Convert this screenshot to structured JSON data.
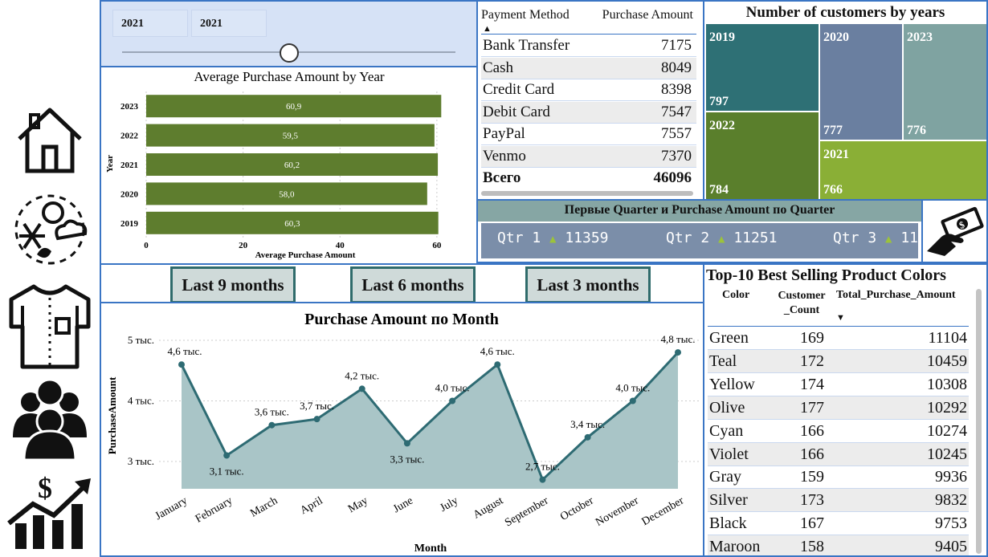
{
  "slicer": {
    "start_year": "2021",
    "end_year": "2021",
    "value_fraction": 0.5
  },
  "payment_table": {
    "col_method": "Payment Method",
    "col_amount": "Purchase Amount",
    "rows": [
      {
        "method": "Bank Transfer",
        "amount": "7175"
      },
      {
        "method": "Cash",
        "amount": "8049"
      },
      {
        "method": "Credit Card",
        "amount": "8398"
      },
      {
        "method": "Debit Card",
        "amount": "7547"
      },
      {
        "method": "PayPal",
        "amount": "7557"
      },
      {
        "method": "Venmo",
        "amount": "7370"
      }
    ],
    "total_label": "Всего",
    "total_value": "46096"
  },
  "treemap": {
    "title": "Number of customers by years",
    "tiles": [
      {
        "year": "2019",
        "count": "797",
        "color": "#2e7075"
      },
      {
        "year": "2020",
        "count": "777",
        "color": "#6a7fa0"
      },
      {
        "year": "2023",
        "count": "776",
        "color": "#7fa3a1"
      },
      {
        "year": "2022",
        "count": "784",
        "color": "#5a7f2c"
      },
      {
        "year": "2021",
        "count": "766",
        "color": "#8aaf36"
      }
    ]
  },
  "kpi_strip": {
    "title": "Первые Quarter и Purchase Amount по Quarter",
    "items": [
      {
        "label": "Qtr 1",
        "value": "11359"
      },
      {
        "label": "Qtr 2",
        "value": "11251"
      },
      {
        "label": "Qtr 3",
        "value": "11"
      }
    ],
    "bg": "#7b8ea9",
    "header_bg": "#86a6a4"
  },
  "tabs": {
    "nine": "Last 9 months",
    "six": "Last 6 months",
    "three": "Last 3 months"
  },
  "top_colors": {
    "title": "Top-10 Best Selling Product Colors",
    "col_color": "Color",
    "col_count": "Customer _Count",
    "col_amount": "Total_Purchase_Amount",
    "rows": [
      {
        "color": "Green",
        "count": "169",
        "amount": "11104"
      },
      {
        "color": "Teal",
        "count": "172",
        "amount": "10459"
      },
      {
        "color": "Yellow",
        "count": "174",
        "amount": "10308"
      },
      {
        "color": "Olive",
        "count": "177",
        "amount": "10292"
      },
      {
        "color": "Cyan",
        "count": "166",
        "amount": "10274"
      },
      {
        "color": "Violet",
        "count": "166",
        "amount": "10245"
      },
      {
        "color": "Gray",
        "count": "159",
        "amount": "9936"
      },
      {
        "color": "Silver",
        "count": "173",
        "amount": "9832"
      },
      {
        "color": "Black",
        "count": "167",
        "amount": "9753"
      },
      {
        "color": "Maroon",
        "count": "158",
        "amount": "9405"
      }
    ]
  },
  "nav": {
    "icons": [
      "home-icon",
      "weather-icon",
      "shirt-icon",
      "customers-icon",
      "growth-icon"
    ],
    "money_icon": "money-hand-icon"
  },
  "chart_data": [
    {
      "type": "bar",
      "orientation": "horizontal",
      "title": "Average Purchase Amount by Year",
      "xlabel": "Average Purchase Amount",
      "ylabel": "Year",
      "categories": [
        "2023",
        "2022",
        "2021",
        "2020",
        "2019"
      ],
      "values": [
        60.9,
        59.5,
        60.2,
        58.0,
        60.3
      ],
      "data_labels": [
        "60,9",
        "59,5",
        "60,2",
        "58,0",
        "60,3"
      ],
      "xlim": [
        0,
        64
      ],
      "x_ticks": [
        "0",
        "20",
        "40",
        "60"
      ],
      "color": "#5e7d2e",
      "grid": true
    },
    {
      "type": "area",
      "title": "Purchase Amount по Month",
      "xlabel": "Month",
      "ylabel": "PurchaseAmount",
      "categories": [
        "January",
        "February",
        "March",
        "April",
        "May",
        "June",
        "July",
        "August",
        "September",
        "October",
        "November",
        "December"
      ],
      "values": [
        4.6,
        3.1,
        3.6,
        3.7,
        4.2,
        3.3,
        4.0,
        4.6,
        2.7,
        3.4,
        4.0,
        4.8
      ],
      "data_labels": [
        "4,6 тыс.",
        "3,1 тыс.",
        "3,6 тыс.",
        "3,7 тыс.",
        "4,2 тыс.",
        "3,3 тыс.",
        "4,0 тыс.",
        "4,6 тыс.",
        "2,7 тыс.",
        "3,4 тыс.",
        "4,0 тыс.",
        "4,8 тыс."
      ],
      "y_ticks": [
        "3 тыс.",
        "4 тыс.",
        "5 тыс."
      ],
      "y_tick_values": [
        3,
        4,
        5
      ],
      "ylim": [
        2.55,
        5.0
      ],
      "line_color": "#2e6b73",
      "fill_color": "#a9c5c7",
      "grid": true
    }
  ]
}
